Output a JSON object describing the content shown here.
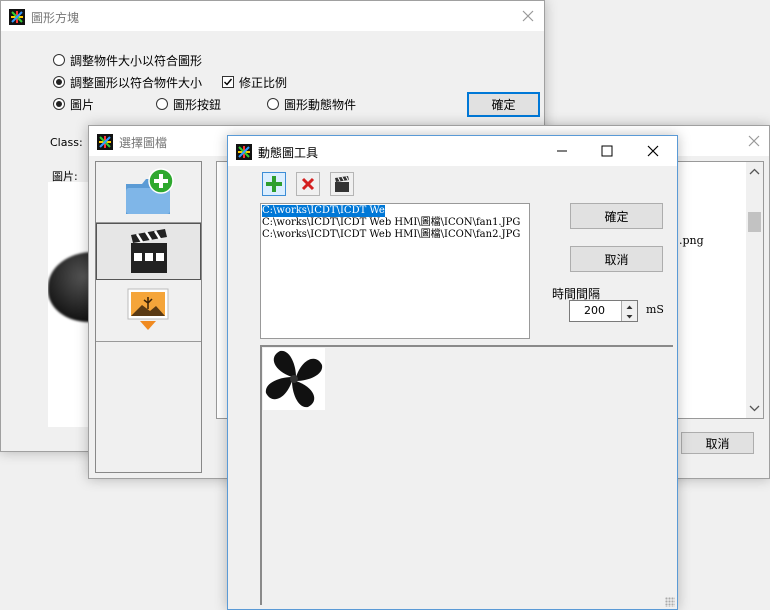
{
  "win1": {
    "title": "圖形方塊",
    "options": [
      "調整物件大小以符合圖形",
      "調整圖形以符合物件大小",
      "修正比例"
    ],
    "types": [
      "圖片",
      "圖形按鈕",
      "圖形動態物件"
    ],
    "ok": "確定",
    "class_label": "Class:",
    "picture_label": "圖片:"
  },
  "win2": {
    "title": "選擇圖檔",
    "list_partial": ".png",
    "cancel": "取消",
    "icons": [
      "add-folder-icon",
      "clapperboard-icon",
      "image-import-icon"
    ]
  },
  "win3": {
    "title": "動態圖工具",
    "toolbar": [
      "add-icon",
      "delete-icon",
      "clapperboard-icon"
    ],
    "files": [
      "C:\\works\\ICDT\\ICDT We",
      "C:\\works\\ICDT\\ICDT Web HMI\\圖檔\\ICON\\fan1.JPG",
      "C:\\works\\ICDT\\ICDT Web HMI\\圖檔\\ICON\\fan2.JPG"
    ],
    "ok": "確定",
    "cancel": "取消",
    "interval_label": "時間間隔",
    "interval_value": "200",
    "unit": "mS"
  },
  "colors": {
    "selection": "#0078d7",
    "accent_green": "#2e9e2e",
    "delete_red": "#d42020"
  }
}
